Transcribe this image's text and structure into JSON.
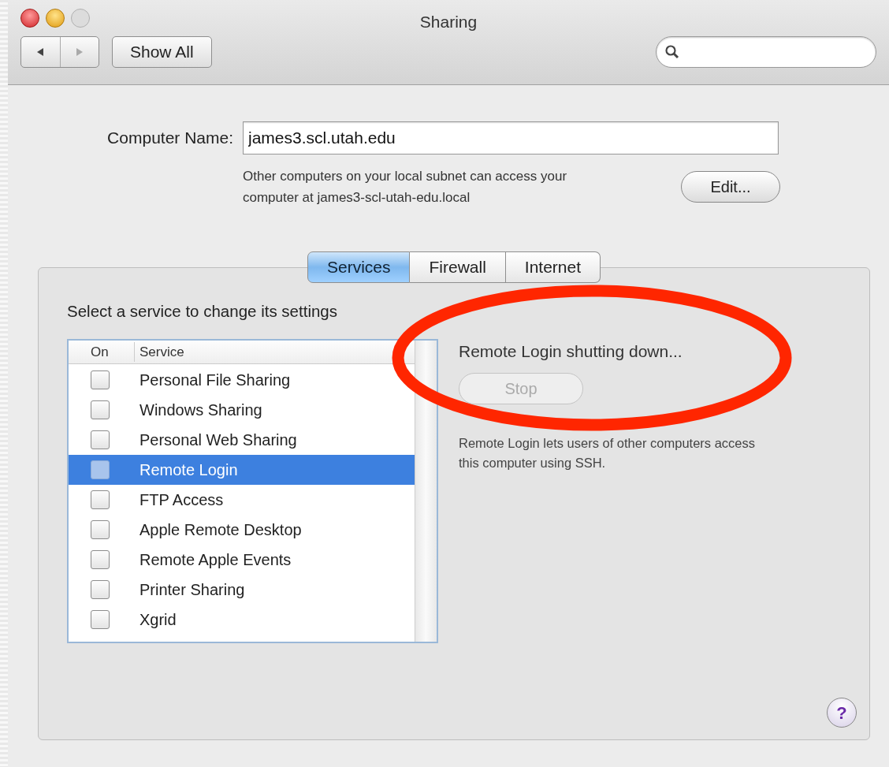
{
  "window": {
    "title": "Sharing"
  },
  "toolbar": {
    "show_all": "Show All"
  },
  "computer_name": {
    "label": "Computer Name:",
    "value": "james3.scl.utah.edu",
    "description": "Other computers on your local subnet can access your computer at james3-scl-utah-edu.local",
    "edit_button": "Edit..."
  },
  "tabs": [
    {
      "label": "Services",
      "selected": true
    },
    {
      "label": "Firewall",
      "selected": false
    },
    {
      "label": "Internet",
      "selected": false
    }
  ],
  "services": {
    "instruction": "Select a service to change its settings",
    "columns": [
      "On",
      "Service"
    ],
    "rows": [
      {
        "name": "Personal File Sharing",
        "checked": false,
        "selected": false
      },
      {
        "name": "Windows Sharing",
        "checked": false,
        "selected": false
      },
      {
        "name": "Personal Web Sharing",
        "checked": false,
        "selected": false
      },
      {
        "name": "Remote Login",
        "checked": false,
        "selected": true
      },
      {
        "name": "FTP Access",
        "checked": false,
        "selected": false
      },
      {
        "name": "Apple Remote Desktop",
        "checked": false,
        "selected": false
      },
      {
        "name": "Remote Apple Events",
        "checked": false,
        "selected": false
      },
      {
        "name": "Printer Sharing",
        "checked": false,
        "selected": false
      },
      {
        "name": "Xgrid",
        "checked": false,
        "selected": false
      }
    ]
  },
  "detail": {
    "status": "Remote Login shutting down...",
    "button": {
      "label": "Stop",
      "disabled": true
    },
    "description": "Remote Login lets users of other computers access this computer using SSH."
  },
  "help_button": "?"
}
